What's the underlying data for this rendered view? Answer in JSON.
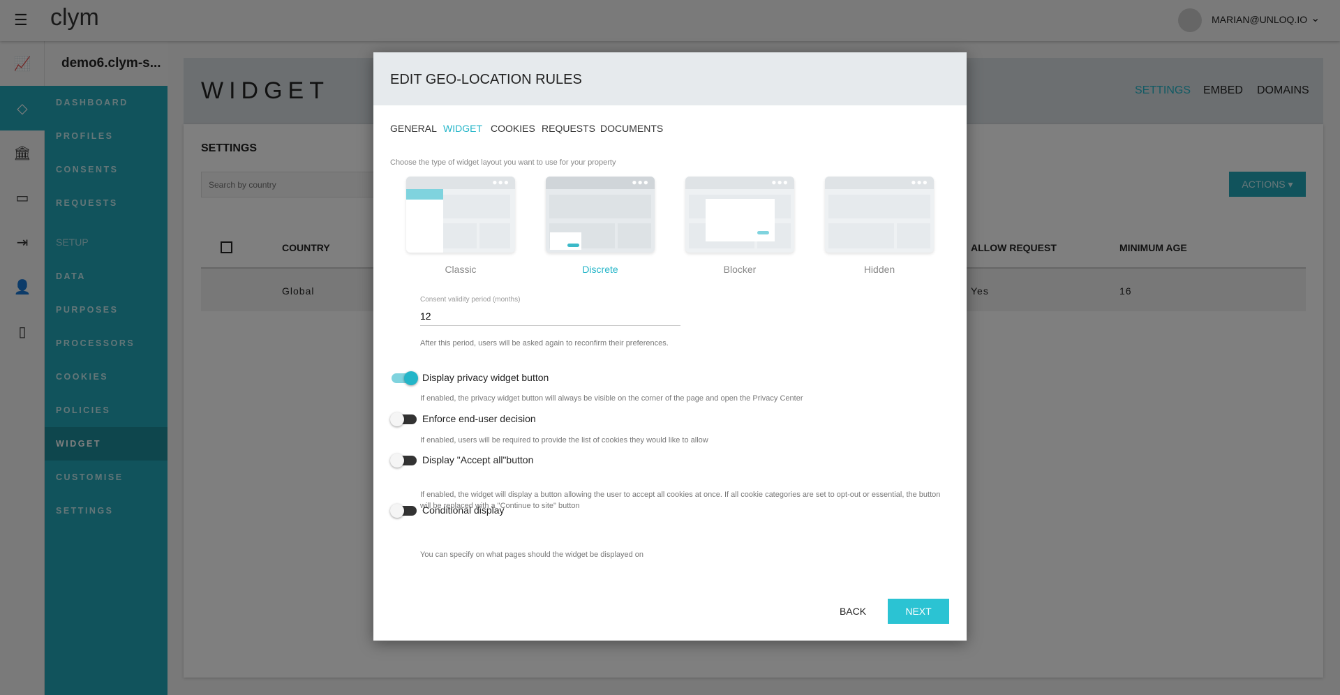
{
  "topbar": {
    "logo": "clym",
    "user": "MARIAN@UNLOQ.IO"
  },
  "sidebar": {
    "property": "demo6.clym-s...",
    "items": [
      {
        "label": "DASHBOARD"
      },
      {
        "label": "PROFILES"
      },
      {
        "label": "CONSENTS"
      },
      {
        "label": "REQUESTS"
      },
      {
        "label": "SETUP",
        "section": true
      },
      {
        "label": "DATA"
      },
      {
        "label": "PURPOSES"
      },
      {
        "label": "PROCESSORS"
      },
      {
        "label": "COOKIES"
      },
      {
        "label": "POLICIES"
      },
      {
        "label": "WIDGET",
        "active": true
      },
      {
        "label": "CUSTOMISE"
      },
      {
        "label": "SETTINGS"
      }
    ]
  },
  "page": {
    "title": "WIDGET",
    "tabs": [
      "SETTINGS",
      "EMBED",
      "DOMAINS"
    ],
    "section": "SETTINGS",
    "search_placeholder": "Search by country",
    "actions": "ACTIONS",
    "columns": [
      "COUNTRY",
      "ALLOW REQUEST",
      "MINIMUM AGE"
    ],
    "rows": [
      {
        "country": "Global",
        "allow": "Yes",
        "age": "16"
      }
    ]
  },
  "modal": {
    "title": "EDIT GEO-LOCATION RULES",
    "tabs": [
      "GENERAL",
      "WIDGET",
      "COOKIES",
      "REQUESTS",
      "DOCUMENTS"
    ],
    "active_tab": "WIDGET",
    "layout_prompt": "Choose the type of widget layout you want to use for your property",
    "layouts": [
      "Classic",
      "Discrete",
      "Blocker",
      "Hidden"
    ],
    "selected_layout": "Discrete",
    "validity": {
      "label": "Consent validity period (months)",
      "value": "12",
      "help": "After this period, users will be asked again to reconfirm their preferences."
    },
    "toggles": [
      {
        "label": "Display privacy widget button",
        "on": true,
        "help": "If enabled, the privacy widget button will always be visible on the corner of the page and open the Privacy Center"
      },
      {
        "label": "Enforce end-user decision",
        "on": false,
        "help": "If enabled, users will be required to provide the list of cookies they would like to allow"
      },
      {
        "label": "Display \"Accept all\"button",
        "on": false,
        "help": "If enabled, the widget will display a button allowing the user to accept all cookies at once. If all cookie categories are set to opt-out or essential, the button will be replaced with a \"Continue to site\" button"
      },
      {
        "label": "Conditional display",
        "on": false,
        "help": "You can specify on what pages should the widget be displayed on"
      }
    ],
    "back": "BACK",
    "next": "NEXT"
  },
  "colors": {
    "accent": "#23b5c8",
    "sidebar": "#23a7b8"
  }
}
